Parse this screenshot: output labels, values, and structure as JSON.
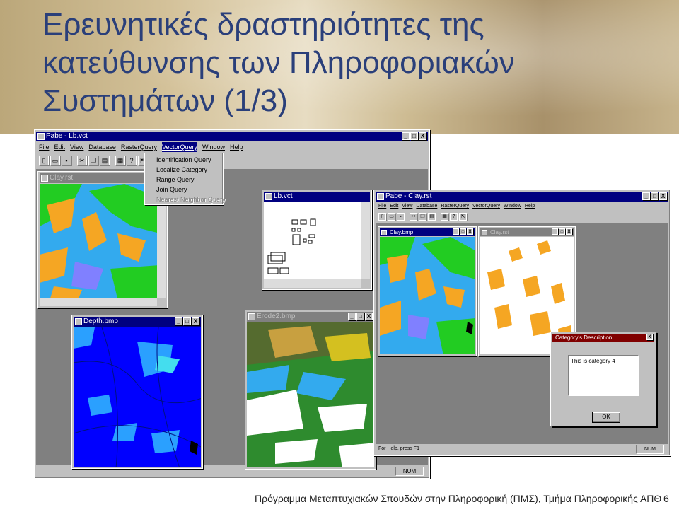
{
  "slide": {
    "title_lines": [
      "Ερευνητικές δραστηριότητες της",
      "κατεύθυνσης των Πληροφοριακών",
      "Συστημάτων (1/3)"
    ],
    "footer": "Πρόγραμμα Μεταπτυχιακών Σπουδών στην Πληροφορική (ΠΜΣ), Τμήμα Πληροφορικής ΑΠΘ",
    "page_number": "6"
  },
  "app1": {
    "title": "Pabe - Lb.vct",
    "menu": [
      "File",
      "Edit",
      "View",
      "Database",
      "RasterQuery",
      "VectorQuery",
      "Window",
      "Help"
    ],
    "vector_menu": [
      "Identification Query",
      "Localize Category",
      "Range Query",
      "Join Query",
      "Nearest Neighbor Query"
    ],
    "windows": {
      "clay": "Clay.rst",
      "lb": "Lb.vct",
      "depth": "Depth.bmp",
      "erode": "Erode2.bmp"
    },
    "status_num": "NUM"
  },
  "app2": {
    "title": "Pabe - Clay.rst",
    "menu": [
      "File",
      "Edit",
      "View",
      "Database",
      "RasterQuery",
      "VectorQuery",
      "Window",
      "Help"
    ],
    "windows": {
      "claybmp": "Clay.bmp",
      "clayrst": "Clay.rst"
    },
    "dialog": {
      "title": "Category's Description",
      "text": "This is category 4",
      "ok": "OK",
      "close": "X"
    },
    "status_help": "For Help, press F1",
    "status_num": "NUM"
  },
  "window_buttons": {
    "min": "_",
    "max": "□",
    "close": "X"
  },
  "colors": {
    "title": "#2a3f7a",
    "titlebar": "#000080",
    "map_orange": "#f5a623",
    "map_cyan": "#33aaee",
    "map_green": "#22cc22",
    "map_blue": "#0000ff",
    "map_darkgreen": "#2e8b2e"
  }
}
